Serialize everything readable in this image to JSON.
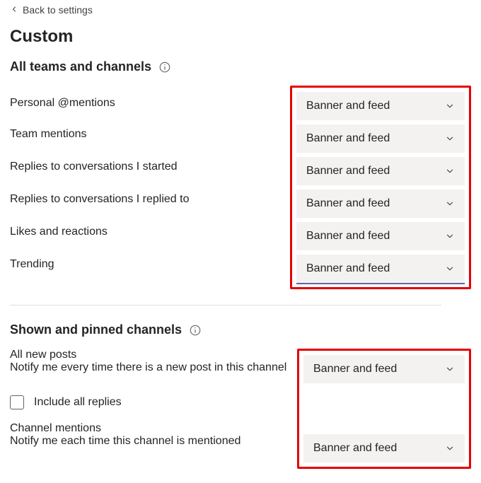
{
  "backLabel": "Back to settings",
  "pageTitle": "Custom",
  "section1": {
    "heading": "All teams and channels",
    "items": [
      {
        "label": "Personal @mentions",
        "value": "Banner and feed"
      },
      {
        "label": "Team mentions",
        "value": "Banner and feed"
      },
      {
        "label": "Replies to conversations I started",
        "value": "Banner and feed"
      },
      {
        "label": "Replies to conversations I replied to",
        "value": "Banner and feed"
      },
      {
        "label": "Likes and reactions",
        "value": "Banner and feed"
      },
      {
        "label": "Trending",
        "value": "Banner and feed"
      }
    ]
  },
  "section2": {
    "heading": "Shown and pinned channels",
    "allNewPosts": {
      "label": "All new posts",
      "sublabel": "Notify me every time there is a new post in this channel",
      "value": "Banner and feed"
    },
    "includeAllReplies": {
      "label": "Include all replies",
      "checked": false
    },
    "channelMentions": {
      "label": "Channel mentions",
      "sublabel": "Notify me each time this channel is mentioned",
      "value": "Banner and feed"
    }
  }
}
